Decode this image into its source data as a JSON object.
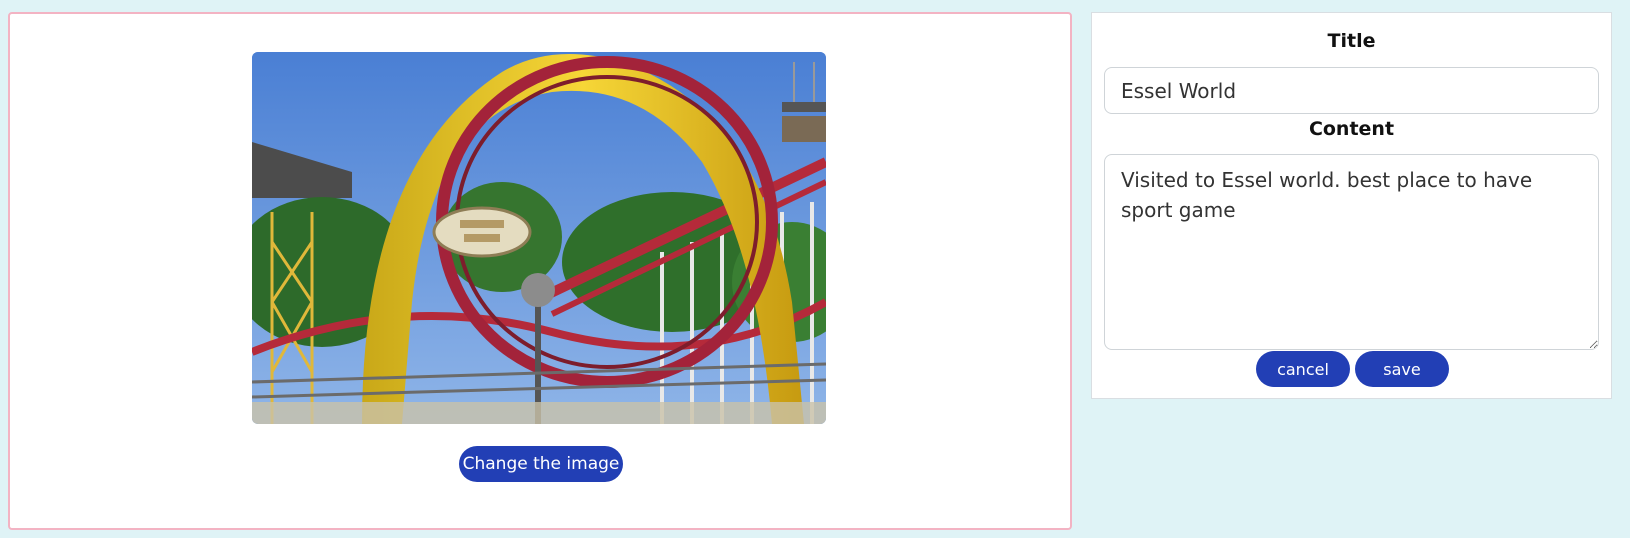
{
  "editor": {
    "image_alt": "Roller coaster loop ride",
    "change_image_label": "Change the image",
    "title_label": "Title",
    "title_value": "Essel World",
    "content_label": "Content",
    "content_value": "Visited to Essel world. best place to have sport game",
    "cancel_label": "cancel",
    "save_label": "save"
  },
  "colors": {
    "page_background": "#dff3f6",
    "accent_button": "#223fb5",
    "left_panel_border": "#f3b3c3"
  }
}
